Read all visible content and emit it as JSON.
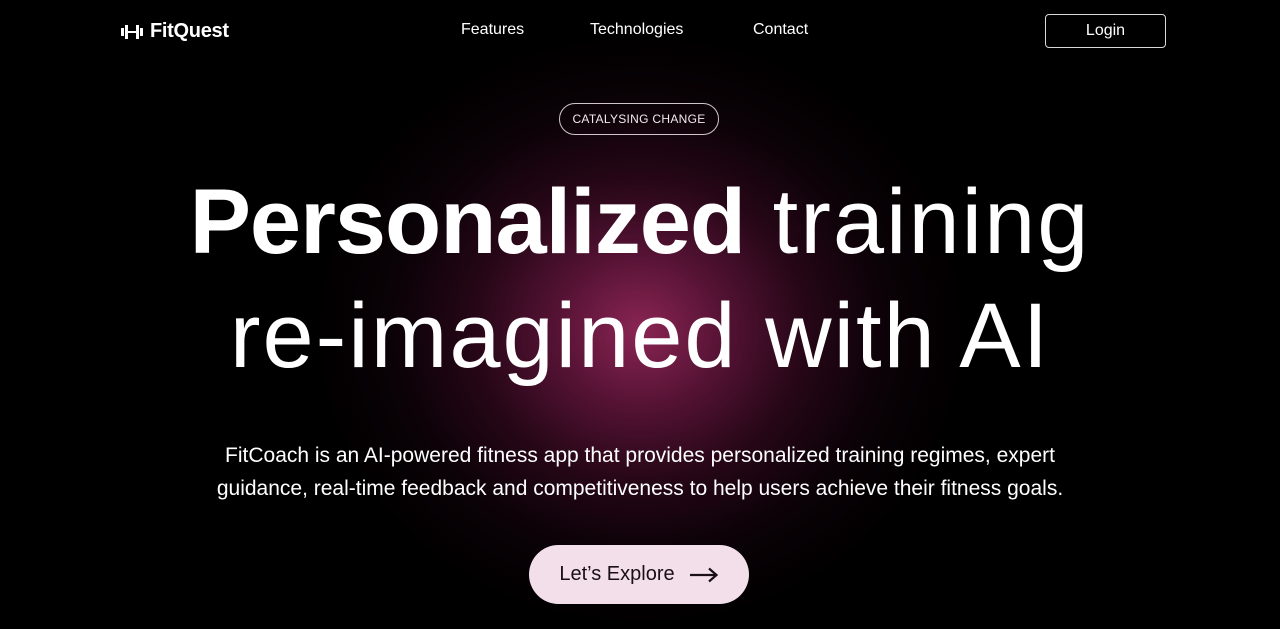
{
  "nav": {
    "logo_icon": "dumbbell-icon",
    "brand": "FitQuest",
    "links": [
      "Features",
      "Technologies",
      "Contact"
    ],
    "login_label": "Login"
  },
  "hero": {
    "badge": "CATALYSING CHANGE",
    "headline_bold": "Personalized",
    "headline_rest_line1": " training",
    "headline_line2": "re-imagined with AI",
    "description": "FitCoach is an AI-powered fitness app that provides personalized training regimes, expert guidance, real-time feedback and competitiveness to help users achieve their fitness goals.",
    "cta_label": "Let’s Explore",
    "cta_icon": "arrow-right-icon"
  },
  "colors": {
    "background": "#000000",
    "glow": "#96285a",
    "cta_background": "#f3dfea",
    "text": "#ffffff"
  }
}
